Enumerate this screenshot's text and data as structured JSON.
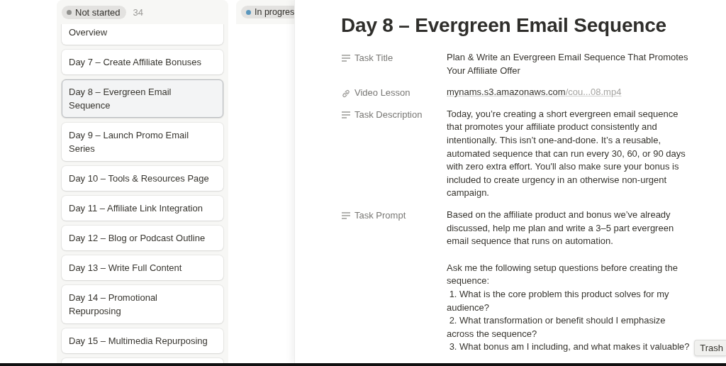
{
  "board": {
    "columns": [
      {
        "status": "Not started",
        "count": "34",
        "color": "#91918e",
        "cards": [
          {
            "title": "Overview",
            "selected": false
          },
          {
            "title": "Day 7 – Create Affiliate Bonuses",
            "selected": false
          },
          {
            "title": "Day 8 – Evergreen Email Sequence",
            "selected": true
          },
          {
            "title": "Day 9 – Launch Promo Email Series",
            "selected": false
          },
          {
            "title": "Day 10 – Tools & Resources Page",
            "selected": false
          },
          {
            "title": "Day 11 – Affiliate Link Integration",
            "selected": false
          },
          {
            "title": "Day 12 – Blog or Podcast Outline",
            "selected": false
          },
          {
            "title": "Day 13 – Write Full Content",
            "selected": false
          },
          {
            "title": "Day 14 – Promotional Repurposing",
            "selected": false
          },
          {
            "title": "Day 15 – Multimedia Repurposing",
            "selected": false
          }
        ]
      },
      {
        "status": "In progres",
        "color": "#5b97bd"
      }
    ]
  },
  "page": {
    "title": "Day 8 – Evergreen Email Sequence",
    "properties": [
      {
        "kind": "text",
        "label": "Task Title",
        "paragraphs": [
          "Plan & Write an Evergreen Email Sequence That Promotes Your Affiliate Offer"
        ]
      },
      {
        "kind": "url",
        "label": "Video Lesson",
        "url_host": "mynams.s3.amazonaws.com",
        "url_path": "/cou...08.mp4"
      },
      {
        "kind": "text",
        "label": "Task Description",
        "paragraphs": [
          "Today, you’re creating a short evergreen email sequence that promotes your affiliate product consistently and intentionally. This isn’t one-and-done. It’s a reusable, automated sequence that can run every 30, 60, or 90 days with zero extra effort. You'll also make sure your bonus is included to create urgency in an otherwise non-urgent campaign."
        ]
      },
      {
        "kind": "text",
        "label": "Task Prompt",
        "paragraphs": [
          "Based on the affiliate product and bonus we’ve already discussed, help me plan and write a 3–5 part evergreen email sequence that runs on automation.",
          "Ask me the following setup questions before creating the sequence:",
          " 1. What is the core problem this product solves for my audience?",
          " 2. What transformation or benefit should I emphasize across the sequence?",
          " 3. What bonus am I including, and what makes it valuable?"
        ]
      }
    ]
  },
  "tooltip": {
    "text": "Trash"
  }
}
